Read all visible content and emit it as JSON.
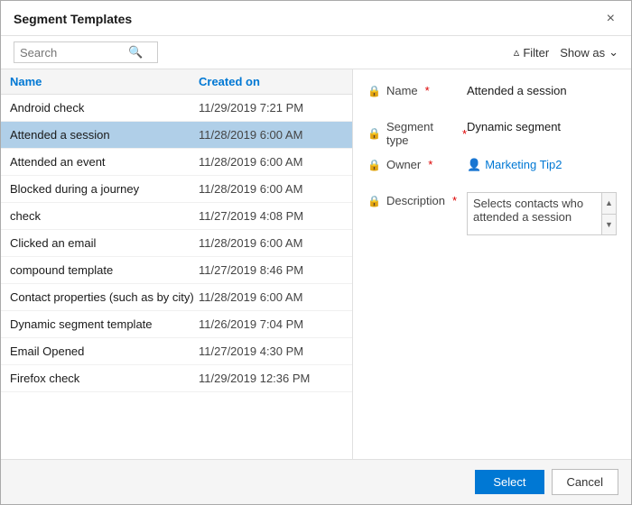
{
  "dialog": {
    "title": "Segment Templates",
    "close_label": "×"
  },
  "toolbar": {
    "search_placeholder": "Search",
    "search_icon": "🔍",
    "filter_label": "Filter",
    "filter_icon": "▽",
    "show_as_label": "Show as",
    "chevron_icon": "∨"
  },
  "list": {
    "col_name": "Name",
    "col_date": "Created on",
    "items": [
      {
        "name": "Android check",
        "date": "11/29/2019 7:21 PM",
        "selected": false
      },
      {
        "name": "Attended a session",
        "date": "11/28/2019 6:00 AM",
        "selected": true
      },
      {
        "name": "Attended an event",
        "date": "11/28/2019 6:00 AM",
        "selected": false
      },
      {
        "name": "Blocked during a journey",
        "date": "11/28/2019 6:00 AM",
        "selected": false
      },
      {
        "name": "check",
        "date": "11/27/2019 4:08 PM",
        "selected": false
      },
      {
        "name": "Clicked an email",
        "date": "11/28/2019 6:00 AM",
        "selected": false
      },
      {
        "name": "compound template",
        "date": "11/27/2019 8:46 PM",
        "selected": false
      },
      {
        "name": "Contact properties (such as by city)",
        "date": "11/28/2019 6:00 AM",
        "selected": false
      },
      {
        "name": "Dynamic segment template",
        "date": "11/26/2019 7:04 PM",
        "selected": false
      },
      {
        "name": "Email Opened",
        "date": "11/27/2019 4:30 PM",
        "selected": false
      },
      {
        "name": "Firefox check",
        "date": "11/29/2019 12:36 PM",
        "selected": false
      }
    ]
  },
  "detail": {
    "name_label": "Name",
    "name_value": "Attended a session",
    "segment_type_label": "Segment type",
    "segment_type_value": "Dynamic segment",
    "owner_label": "Owner",
    "owner_value": "Marketing Tip2",
    "description_label": "Description",
    "description_value": "Selects contacts who attended a session"
  },
  "footer": {
    "select_label": "Select",
    "cancel_label": "Cancel"
  }
}
